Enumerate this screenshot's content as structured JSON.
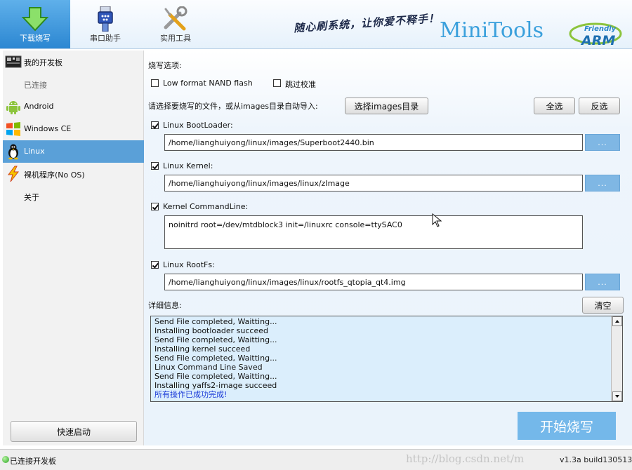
{
  "header": {
    "nav": [
      {
        "label": "下载烧写",
        "icon": "download-arrow-icon",
        "active": true
      },
      {
        "label": "串口助手",
        "icon": "serial-port-icon",
        "active": false
      },
      {
        "label": "实用工具",
        "icon": "tools-icon",
        "active": false
      }
    ],
    "slogan": "随心刷系统，让你爱不释手！",
    "brand": "MiniTools",
    "logo_top": "Friendly",
    "logo_bottom": "ARM"
  },
  "sidebar": {
    "items": [
      {
        "label": "我的开发板",
        "icon": "board-icon"
      },
      {
        "label": "已连接",
        "icon": ""
      },
      {
        "label": "Android",
        "icon": "android-icon"
      },
      {
        "label": "Windows CE",
        "icon": "windows-icon"
      },
      {
        "label": "Linux",
        "icon": "tux-icon",
        "selected": true
      },
      {
        "label": "裸机程序(No OS)",
        "icon": "lightning-icon"
      },
      {
        "label": "关于",
        "icon": ""
      }
    ],
    "quick_start": "快速启动"
  },
  "main": {
    "options_label": "烧写选项:",
    "low_format": {
      "label": "Low format NAND flash",
      "checked": false
    },
    "skip_verify": {
      "label": "跳过校准",
      "checked": false
    },
    "choose_prompt": "请选择要烧写的文件，或从images目录自动导入:",
    "choose_images_btn": "选择images目录",
    "select_all_btn": "全选",
    "invert_btn": "反选",
    "bootloader": {
      "label": "Linux BootLoader:",
      "checked": true,
      "path": "/home/lianghuiyong/linux/images/Superboot2440.bin"
    },
    "kernel": {
      "label": "Linux Kernel:",
      "checked": true,
      "path": "/home/lianghuiyong/linux/images/linux/zImage"
    },
    "cmdline": {
      "label": "Kernel CommandLine:",
      "checked": true,
      "value": "noinitrd root=/dev/mtdblock3 init=/linuxrc console=ttySAC0"
    },
    "rootfs": {
      "label": "Linux RootFs:",
      "checked": true,
      "path": "/home/lianghuiyong/linux/images/linux/rootfs_qtopia_qt4.img"
    },
    "browse_label": "...",
    "detail_label": "详细信息:",
    "clear_btn": "清空",
    "log": [
      "Send File completed, Waitting...",
      "Installing bootloader succeed",
      "Send File completed, Waitting...",
      "Installing kernel succeed",
      "Send File completed, Waitting...",
      "Linux Command Line Saved",
      "Send File completed, Waitting...",
      "Installing yaffs2-image succeed",
      "所有操作已成功完成!"
    ],
    "start_btn": "开始烧写"
  },
  "status": {
    "text": "已连接开发板",
    "watermark": "http://blog.csdn.net/m",
    "version": "v1.3a build130513"
  },
  "colors": {
    "accent": "#5aa0d8",
    "start_button": "#74b8ea",
    "log_background": "#dbeefc",
    "success_text": "#1c3cd8"
  }
}
